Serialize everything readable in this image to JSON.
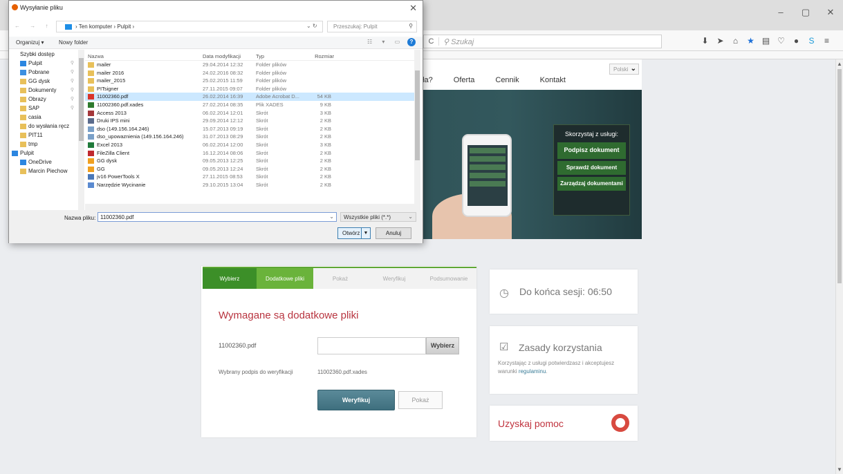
{
  "window": {
    "minimize": "–",
    "maximize": "▢",
    "close": "✕"
  },
  "browser": {
    "reload_icon": "C",
    "search_placeholder": "Szukaj"
  },
  "site": {
    "nav": [
      "ała?",
      "Oferta",
      "Cennik",
      "Kontakt"
    ],
    "lang": "Polski",
    "promo": {
      "title": "Skorzystaj z usługi:",
      "btn1": "Podpisz dokument",
      "btn2": "Sprawdź dokument",
      "btn3": "Zarządzaj dokumentami"
    }
  },
  "wizard": {
    "steps": [
      "Wybierz",
      "Dodatkowe pliki",
      "Pokaż",
      "Weryfikuj",
      "Podsumowanie"
    ],
    "title": "Wymagane są dodatkowe pliki",
    "file_label": "11002360.pdf",
    "choose_btn": "Wybierz",
    "sig_label": "Wybrany podpis do weryfikacji",
    "sig_value": "11002360.pdf.xades",
    "verify_btn": "Weryfikuj",
    "show_btn": "Pokaż"
  },
  "side": {
    "timer": "Do końca sesji: 06:50",
    "rules_title": "Zasady korzystania",
    "rules_text": "Korzystając z usługi potwierdzasz i akceptujesz warunki",
    "rules_link": "regulaminu",
    "rules_end": ".",
    "help": "Uzyskaj pomoc"
  },
  "dialog": {
    "title": "Wysyłanie pliku",
    "path": "› Ten komputer › Pulpit ›",
    "search_placeholder": "Przeszukaj: Pulpit",
    "organize": "Organizuj ▾",
    "new_folder": "Nowy folder",
    "tree": [
      {
        "label": "Szybki dostęp",
        "top": true
      },
      {
        "label": "Pulpit"
      },
      {
        "label": "Pobrane"
      },
      {
        "label": "GG dysk"
      },
      {
        "label": "Dokumenty"
      },
      {
        "label": "Obrazy"
      },
      {
        "label": "SAP"
      },
      {
        "label": "casia"
      },
      {
        "label": "do wysłania ręcz"
      },
      {
        "label": "PIT11"
      },
      {
        "label": "tmp"
      },
      {
        "label": "Pulpit",
        "top": true
      },
      {
        "label": "OneDrive"
      },
      {
        "label": "Marcin Piechow"
      }
    ],
    "columns": [
      "Nazwa",
      "Data modyfikacji",
      "Typ",
      "Rozmiar"
    ],
    "files": [
      [
        "mailer",
        "29.04.2014 12:32",
        "Folder plików",
        ""
      ],
      [
        "mailer 2016",
        "24.02.2016 08:32",
        "Folder plików",
        ""
      ],
      [
        "mailer_2015",
        "25.02.2015 11:59",
        "Folder plików",
        ""
      ],
      [
        "PITsigner",
        "27.11.2015 09:07",
        "Folder plików",
        ""
      ],
      [
        "11002360.pdf",
        "26.02.2014 16:39",
        "Adobe Acrobat D...",
        "54 KB"
      ],
      [
        "11002360.pdf.xades",
        "27.02.2014 08:35",
        "Plik XADES",
        "9 KB"
      ],
      [
        "Access 2013",
        "06.02.2014 12:01",
        "Skrót",
        "3 KB"
      ],
      [
        "Druki IPS mini",
        "29.09.2014 12:12",
        "Skrót",
        "2 KB"
      ],
      [
        "dso (149.156.164.246)",
        "15.07.2013 09:19",
        "Skrót",
        "2 KB"
      ],
      [
        "dso_upowaznienia (149.156.164.246)",
        "31.07.2013 08:29",
        "Skrót",
        "2 KB"
      ],
      [
        "Excel 2013",
        "06.02.2014 12:00",
        "Skrót",
        "3 KB"
      ],
      [
        "FileZilla Client",
        "16.12.2014 08:06",
        "Skrót",
        "2 KB"
      ],
      [
        "GG dysk",
        "09.05.2013 12:25",
        "Skrót",
        "2 KB"
      ],
      [
        "GG",
        "09.05.2013 12:24",
        "Skrót",
        "2 KB"
      ],
      [
        "jv16 PowerTools X",
        "27.11.2015 08:53",
        "Skrót",
        "2 KB"
      ],
      [
        "Narzędzie Wycinanie",
        "29.10.2015 13:04",
        "Skrót",
        "2 KB"
      ]
    ],
    "filename_label": "Nazwa pliku:",
    "filename_value": "11002360.pdf",
    "filetype": "Wszystkie pliki (*.*)",
    "open_btn": "Otwórz",
    "cancel_btn": "Anuluj"
  }
}
